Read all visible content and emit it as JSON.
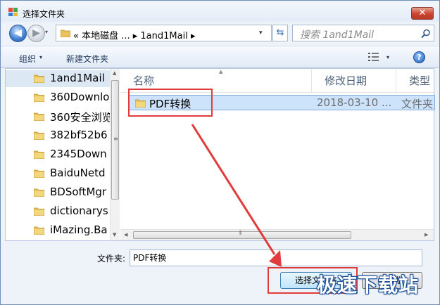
{
  "window": {
    "title": "选择文件夹",
    "close_glyph": "✕"
  },
  "nav": {
    "back_glyph": "◀",
    "forward_glyph": "▶",
    "dropdown_glyph": "▾",
    "address": "« 本地磁盘 ...  ▸ 1and1Mail  ▸",
    "address_dropdown_glyph": "▾",
    "refresh_glyph": "⇆",
    "search_placeholder": "搜索 1and1Mail"
  },
  "toolbar": {
    "organize": "组织",
    "organize_dd": "▾",
    "new_folder": "新建文件夹",
    "view_dd": "▾",
    "help_glyph": "?"
  },
  "sidebar": {
    "items": [
      {
        "label": "1and1Mail",
        "selected": true
      },
      {
        "label": "360Downlo"
      },
      {
        "label": "360安全浏览"
      },
      {
        "label": "382bf52b6"
      },
      {
        "label": "2345Down"
      },
      {
        "label": "BaiduNetd"
      },
      {
        "label": "BDSoftMgr"
      },
      {
        "label": "dictionarys"
      },
      {
        "label": "iMazing.Ba"
      }
    ],
    "grip": "≡",
    "up_arrow": "▲",
    "down_arrow": "▼"
  },
  "file_list": {
    "columns": {
      "name": "名称",
      "date": "修改日期",
      "type": "类型"
    },
    "sort_glyph": "▲",
    "rows": [
      {
        "name": "PDF转换",
        "date": "2018-03-10 ...",
        "type": "文件夹"
      }
    ],
    "hscroll_grip": "⦀",
    "left_arrow": "◀",
    "right_arrow": "▶"
  },
  "footer": {
    "folder_label": "文件夹:",
    "folder_value": "PDF转换",
    "select_button": "选择文件夹",
    "cancel_button": "取消"
  },
  "watermark": "极速下载站",
  "colors": {
    "highlight": "#e23b3b",
    "selection": "#cde2fb",
    "accent": "#3c7fb1"
  }
}
